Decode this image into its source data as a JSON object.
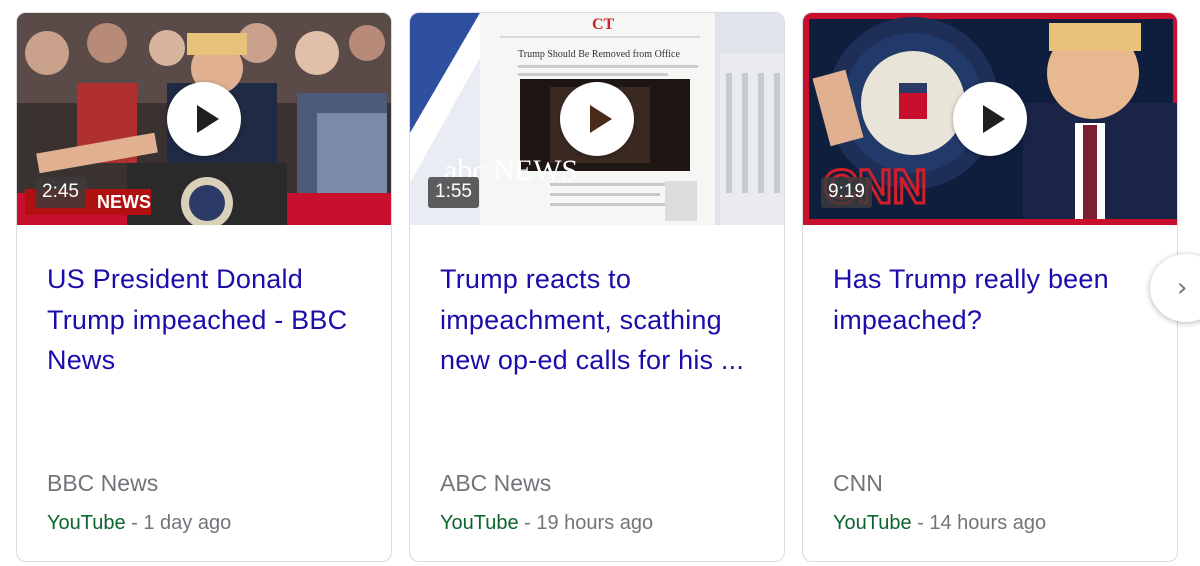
{
  "cards": [
    {
      "duration": "2:45",
      "title": "US President Donald Trump impeached - BBC News",
      "source": "BBC News",
      "platform": "YouTube",
      "separator": " - ",
      "age": "1 day ago",
      "thumb_overlay": "NEWS"
    },
    {
      "duration": "1:55",
      "title": "Trump reacts to impeachment, scathing new op-ed calls for his ...",
      "source": "ABC News",
      "platform": "YouTube",
      "separator": " - ",
      "age": "19 hours ago",
      "thumb_overlay": "abc NEWS",
      "thumb_masthead": "CT",
      "thumb_headline": "Trump Should Be Removed from Office"
    },
    {
      "duration": "9:19",
      "title": "Has Trump really been impeached?",
      "source": "CNN",
      "platform": "YouTube",
      "separator": " - ",
      "age": "14 hours ago",
      "thumb_overlay": "CNN"
    }
  ],
  "next_button_icon": "chevron-right-icon",
  "colors": {
    "link": "#1a0dab",
    "platform": "#0d652d",
    "secondary": "#70757a",
    "border": "#dadce0"
  }
}
